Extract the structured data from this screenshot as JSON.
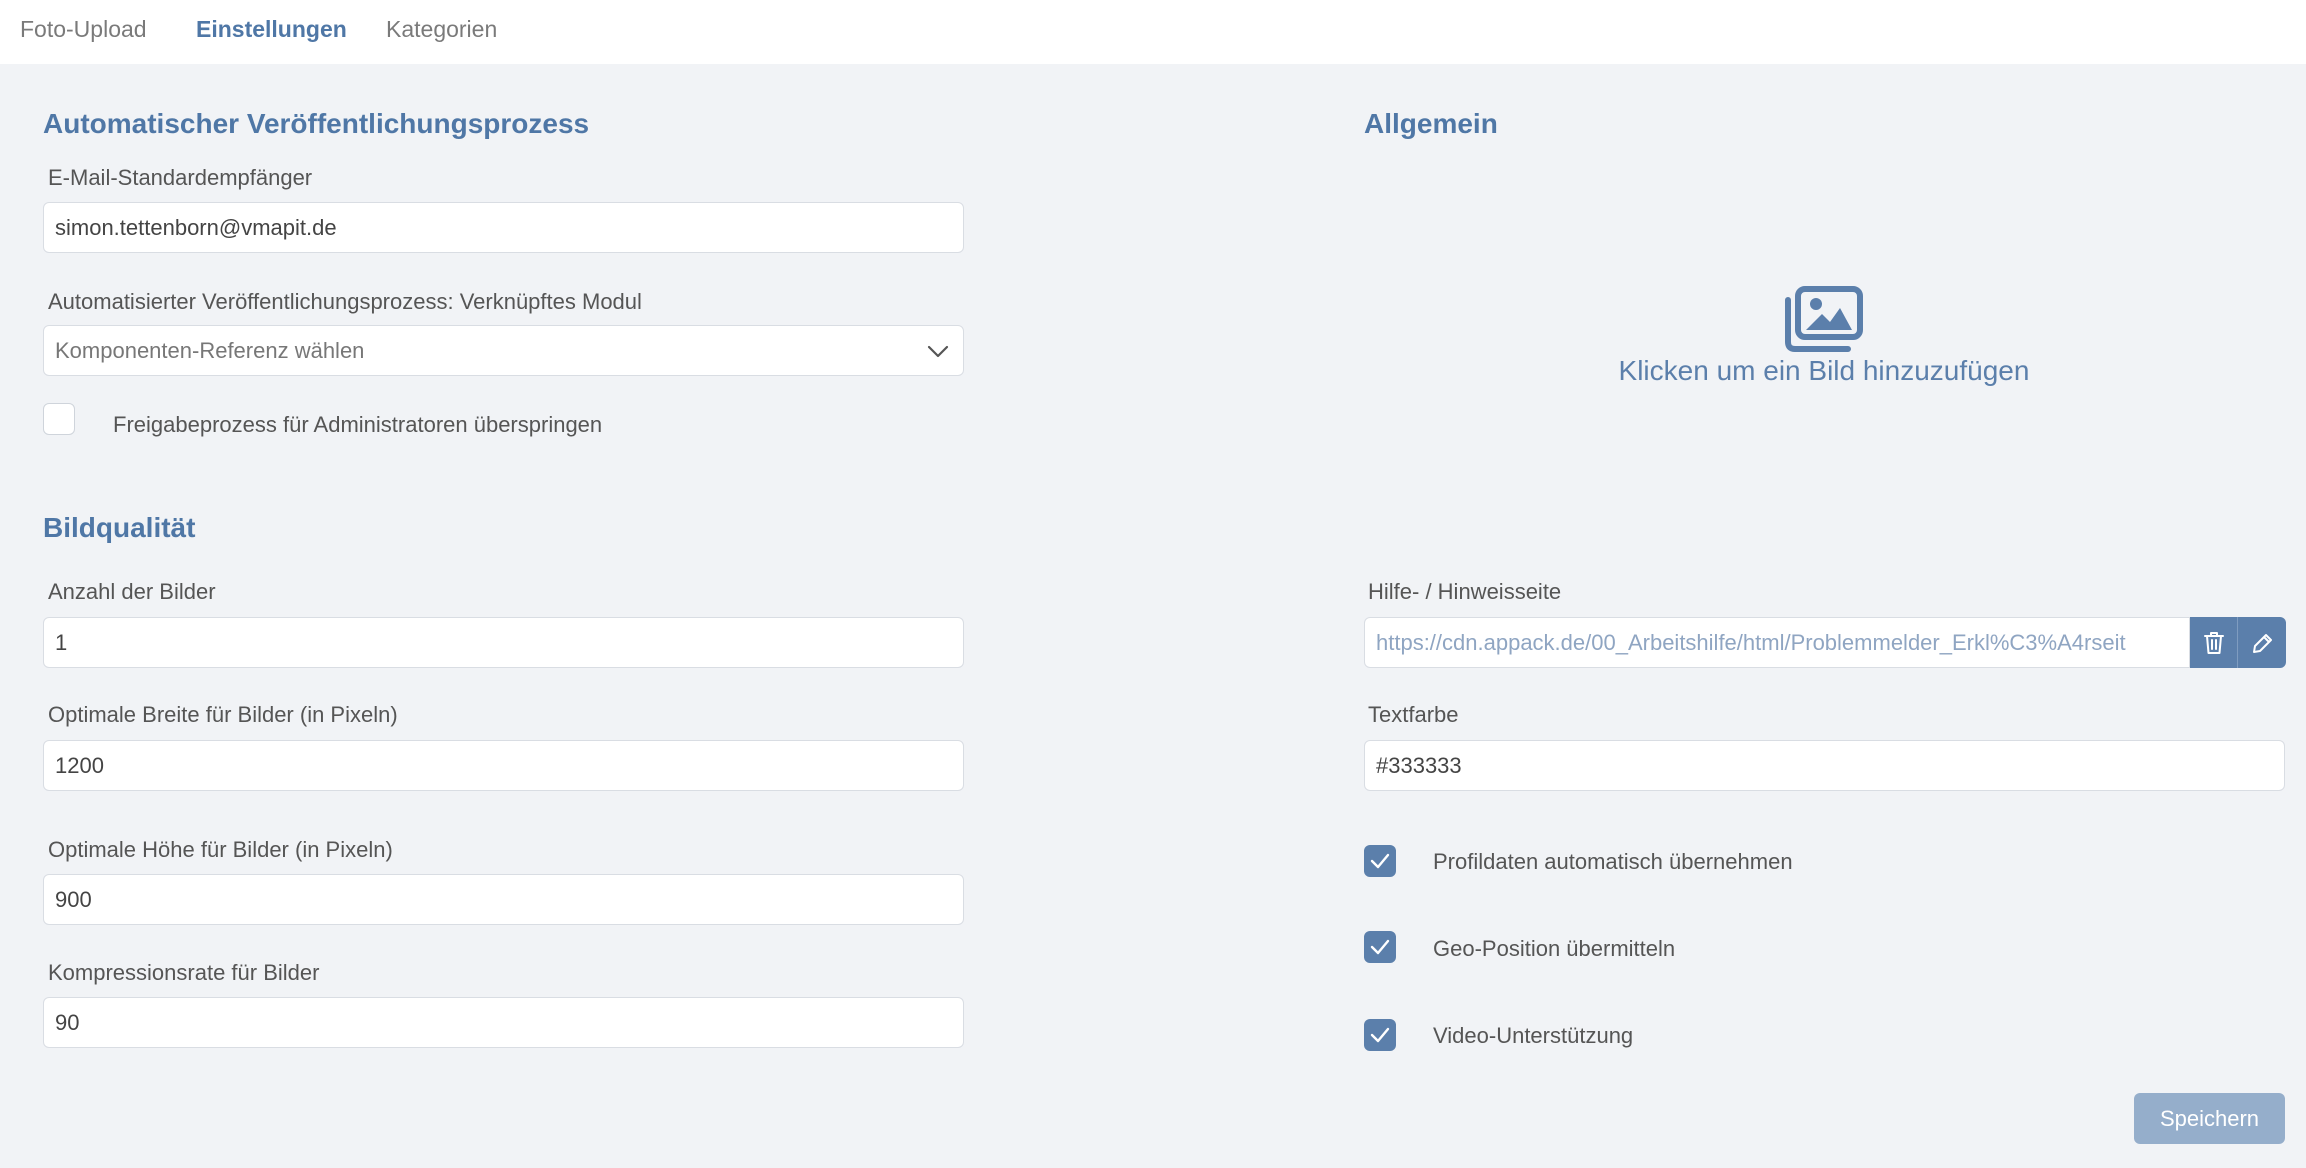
{
  "tabs": [
    {
      "label": "Foto-Upload",
      "active": false
    },
    {
      "label": "Einstellungen",
      "active": true
    },
    {
      "label": "Kategorien",
      "active": false
    }
  ],
  "publishing": {
    "heading": "Automatischer Veröffentlichungsprozess",
    "email_label": "E-Mail-Standardempfänger",
    "email_value": "simon.tettenborn@vmapit.de",
    "module_label": "Automatisierter Veröffentlichungsprozess: Verknüpftes Modul",
    "module_placeholder": "Komponenten-Referenz wählen",
    "skip_admin_label": "Freigabeprozess für Administratoren überspringen",
    "skip_admin_checked": false
  },
  "general": {
    "heading": "Allgemein",
    "image_drop_text": "Klicken um ein Bild hinzuzufügen",
    "help_label": "Hilfe- / Hinweisseite",
    "help_url": "https://cdn.appack.de/00_Arbeitshilfe/html/Problemmelder_Erkl%C3%A4rseit",
    "textcolor_label": "Textfarbe",
    "textcolor_value": "#333333",
    "profile_label": "Profildaten automatisch übernehmen",
    "profile_checked": true,
    "geo_label": "Geo-Position übermitteln",
    "geo_checked": true,
    "video_label": "Video-Unterstützung",
    "video_checked": true
  },
  "quality": {
    "heading": "Bildqualität",
    "count_label": "Anzahl der Bilder",
    "count_value": "1",
    "width_label": "Optimale Breite für Bilder (in Pixeln)",
    "width_value": "1200",
    "height_label": "Optimale Höhe für Bilder (in Pixeln)",
    "height_value": "900",
    "compression_label": "Kompressionsrate für Bilder",
    "compression_value": "90"
  },
  "actions": {
    "save_label": "Speichern"
  },
  "icons": {
    "chevron": "chevron-down-icon",
    "trash": "trash-icon",
    "edit": "pencil-icon",
    "image": "images-icon",
    "check": "check-icon"
  },
  "colors": {
    "accent": "#4f77a6",
    "checkbox": "#5b7fab",
    "save_button": "#95aecb",
    "background": "#f1f3f6"
  }
}
